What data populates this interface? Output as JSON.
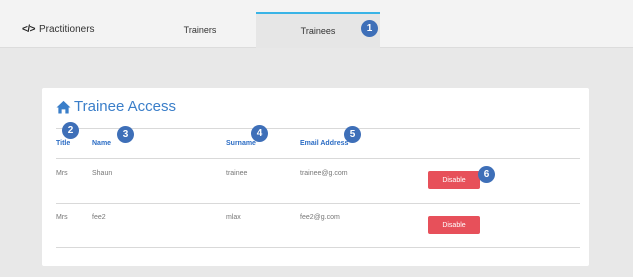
{
  "nav": {
    "brand_icon": "</>",
    "brand_label": "Practitioners",
    "tabs": [
      {
        "label": "Trainers"
      },
      {
        "label": "Trainees"
      }
    ]
  },
  "markers": [
    "1",
    "2",
    "3",
    "4",
    "5",
    "6"
  ],
  "card": {
    "title": "Trainee Access",
    "home_icon": "home-icon",
    "columns": {
      "title": "Title",
      "name": "Name",
      "surname": "Surname",
      "email": "Email Address"
    },
    "rows": [
      {
        "title": "Mrs",
        "name": "Shaun",
        "surname": "trainee",
        "email": "trainee@g.com",
        "action": "Disable"
      },
      {
        "title": "Mrs",
        "name": "fee2",
        "surname": "mlax",
        "email": "fee2@g.com",
        "action": "Disable"
      }
    ]
  },
  "colors": {
    "accent": "#3a7ec9",
    "tab_indicator": "#3ab4e6",
    "marker": "#3e6fb8",
    "danger_button": "#e7505a",
    "header_text": "#2b6cc4"
  }
}
